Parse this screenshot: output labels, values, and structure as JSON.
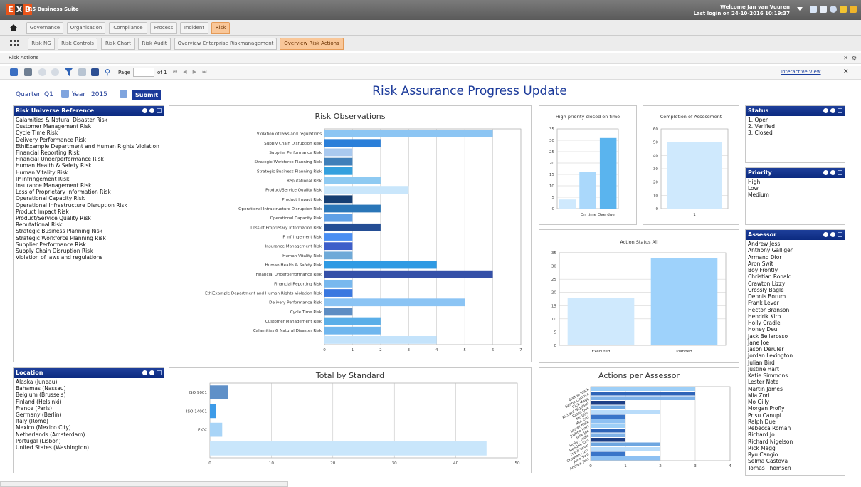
{
  "app": {
    "logo_letters": [
      "E",
      "X",
      "B"
    ],
    "title": "R5 Business Suite",
    "welcome_line1": "Welcome Jan van Vuuren",
    "welcome_line2": "Last login on 24-10-2016 10:19:37"
  },
  "tabs_main": [
    "Governance",
    "Organisation",
    "Compliance",
    "Process",
    "Incident",
    "Risk"
  ],
  "tabs_sub": [
    "Risk NG",
    "Risk Controls",
    "Risk Chart",
    "Risk Audit",
    "Overview Enterprise Riskmanagement",
    "Overview Risk Actions"
  ],
  "section_title": "Risk Actions",
  "toolbar": {
    "page_label": "Page",
    "page_value": "1",
    "page_of": "of 1",
    "interactive_view": "Interactive View"
  },
  "filters": {
    "quarter_label": "Quarter",
    "quarter_value": "Q1",
    "year_label": "Year",
    "year_value": "2015",
    "submit": "Submit"
  },
  "dashboard_title": "Risk Assurance Progress Update",
  "panels": {
    "risk_universe": {
      "title": "Risk Universe Reference",
      "items": [
        "Calamities & Natural Disaster Risk",
        "Customer Management Risk",
        "Cycle Time Risk",
        "Delivery Performance Risk",
        "EthiExample Department and Human Rights Violation",
        "Financial Reporting Risk",
        "Financial Underperformance Risk",
        "Human Health & Safety Risk",
        "Human Vitality Risk",
        "IP infringement Risk",
        "Insurance Management Risk",
        "Loss of Proprietary Information Risk",
        "Operational Capacity Risk",
        "Operational Infrastructure Disruption Risk",
        "Product Impact Risk",
        "Product/Service Quality Risk",
        "Reputational Risk",
        "Strategic Business Planning Risk",
        "Strategic Workforce Planning Risk",
        "Supplier Performance Risk",
        "Supply Chain Disruption Risk",
        "Violation of laws and regulations"
      ]
    },
    "location": {
      "title": "Location",
      "items": [
        "Alaska (Juneau)",
        "Bahamas (Nassau)",
        "Belgium (Brussels)",
        "Finland (Helsinki)",
        "France (Paris)",
        "Germany (Berlin)",
        "Italy (Rome)",
        "Mexico (Mexico City)",
        "Netherlands (Amsterdam)",
        "Portugal (Lisbon)",
        "United States (Washington)"
      ]
    },
    "status": {
      "title": "Status",
      "items": [
        "1. Open",
        "2. Verified",
        "3. Closed"
      ]
    },
    "priority": {
      "title": "Priority",
      "items": [
        "High",
        "Low",
        "Medium"
      ]
    },
    "assessor": {
      "title": "Assessor",
      "items": [
        "Andrew Jess",
        "Anthony Galliger",
        "Armand Dior",
        "Aron Swit",
        "Boy Frontly",
        "Christian Ronald",
        "Crawton Lizzy",
        "Crossly Bagle",
        "Dennis Borum",
        "Frank Lever",
        "Hector Branson",
        "Hendrik Kiro",
        "Holly Cradle",
        "Honey Deu",
        "Jack Bellarosso",
        "Jane Joe",
        "Jason Deruler",
        "Jordan Lexington",
        "Julian Bird",
        "Justine Hart",
        "Katie Simmons",
        "Lester Note",
        "Martin James",
        "Mia Zori",
        "Mo Gilly",
        "Morgan Profly",
        "Prisu Canupi",
        "Ralph Due",
        "Rebecca Roman",
        "Richard Jo",
        "Richard Nigelson",
        "Rick Magg",
        "Ryu Cangio",
        "Selma Castova",
        "Tomas Thomsen"
      ]
    }
  },
  "colors": {
    "brand": "#e8541a",
    "header_blue": "#0b2a80",
    "active_tab": "#f9c799",
    "bar_light": "#b6ddfb",
    "bar_mid": "#5ab4ee"
  },
  "chart_data": [
    {
      "id": "risk_observations",
      "type": "bar",
      "orientation": "horizontal",
      "title": "Risk Observations",
      "categories": [
        "Violation of laws and regulations",
        "Supply Chain Disruption Risk",
        "Supplier Performance Risk",
        "Strategic Workforce Planning Risk",
        "Strategic Business Planning Risk",
        "Reputational Risk",
        "Product/Service Quality Risk",
        "Product Impact Risk",
        "Operational Infrastructure Disruption Risk",
        "Operational Capacity Risk",
        "Loss of Proprietary Information Risk",
        "IP infringement Risk",
        "Insurance Management Risk",
        "Human Vitality Risk",
        "Human Health & Safety Risk",
        "Financial Underperformance Risk",
        "Financial Reporting Risk",
        "EthiExample Department and Human Rights Violation Risk",
        "Delivery Performance Risk",
        "Cycle Time Risk",
        "Customer Management Risk",
        "Calamities & Natural Disaster Risk",
        ""
      ],
      "values": [
        6,
        2,
        1,
        1,
        1,
        2,
        3,
        1,
        2,
        1,
        2,
        1,
        1,
        1,
        4,
        6,
        1,
        1,
        5,
        1,
        2,
        2,
        4
      ],
      "colors": [
        "#8cc5f3",
        "#2b7fd9",
        "#a9c9ef",
        "#3f7fb9",
        "#34a0de",
        "#8ecaf2",
        "#c9e6fb",
        "#153e73",
        "#2a76b8",
        "#5fa0e6",
        "#244e95",
        "#4a8ef2",
        "#3d5ec9",
        "#6ea9d8",
        "#2f9ae3",
        "#3550a8",
        "#78b8ee",
        "#3a78e0",
        "#8bc4f4",
        "#5d8dc3",
        "#5aaee8",
        "#6fb6ee",
        "#c4e3fb"
      ],
      "xticks": [
        0,
        1,
        2,
        3,
        4,
        5,
        6,
        7
      ],
      "xlim": [
        0,
        7
      ]
    },
    {
      "id": "high_priority",
      "type": "bar",
      "title": "High priority closed on time",
      "categories": [
        "",
        "On time",
        "Overdue"
      ],
      "values": [
        4,
        16,
        31
      ],
      "colors": [
        "#cfe9fd",
        "#aad8fb",
        "#5ab4ee"
      ],
      "yticks": [
        0,
        5,
        10,
        15,
        20,
        25,
        30,
        35
      ],
      "ylim": [
        0,
        35
      ],
      "xlabel_text": "On time Overdue"
    },
    {
      "id": "completion",
      "type": "bar",
      "title": "Completion of Assessment",
      "categories": [
        "1"
      ],
      "values": [
        50
      ],
      "colors": [
        "#cfe9fd"
      ],
      "yticks": [
        0,
        10,
        20,
        30,
        40,
        50,
        60
      ],
      "ylim": [
        0,
        60
      ]
    },
    {
      "id": "action_status",
      "type": "bar",
      "title": "Action Status All",
      "categories": [
        "Executed",
        "Planned"
      ],
      "values": [
        18,
        33
      ],
      "colors": [
        "#cfe9fd",
        "#9ed2fb"
      ],
      "yticks": [
        0,
        5,
        10,
        15,
        20,
        25,
        30,
        35
      ],
      "ylim": [
        0,
        35
      ]
    },
    {
      "id": "total_by_standard",
      "type": "bar",
      "orientation": "horizontal",
      "title": "Total by Standard",
      "categories": [
        "ISO 9001",
        "ISO 14001",
        "EICC",
        ""
      ],
      "values": [
        3,
        1,
        2,
        45
      ],
      "colors": [
        "#5f90c8",
        "#3d9be8",
        "#a8d4f7",
        "#c9e6fb"
      ],
      "xticks": [
        0,
        10,
        20,
        30,
        40,
        50
      ],
      "xlim": [
        0,
        50
      ]
    },
    {
      "id": "actions_per_assessor",
      "type": "bar",
      "orientation": "horizontal",
      "title": "Actions per Assessor",
      "categories": [
        "Walton Stark",
        "Selma Castova",
        "Rick Magg",
        "Richard Nigelson",
        "Ralph Due",
        "Mo Gilly",
        "Mia Zori",
        "Lester Note",
        "Justine Hart",
        "Jane Joe",
        "Holly Cradle",
        "Hendrik Kiro",
        "Frank Lever",
        "Crawton Lizzy",
        "Aron Swit",
        "Andrew Jess"
      ],
      "values": [
        3,
        3,
        3,
        1,
        1,
        2,
        1,
        1,
        1,
        1,
        1,
        1,
        2,
        2,
        1,
        2
      ],
      "xticks": [
        0,
        1,
        2,
        3,
        4
      ],
      "xlim": [
        0,
        4
      ]
    }
  ]
}
